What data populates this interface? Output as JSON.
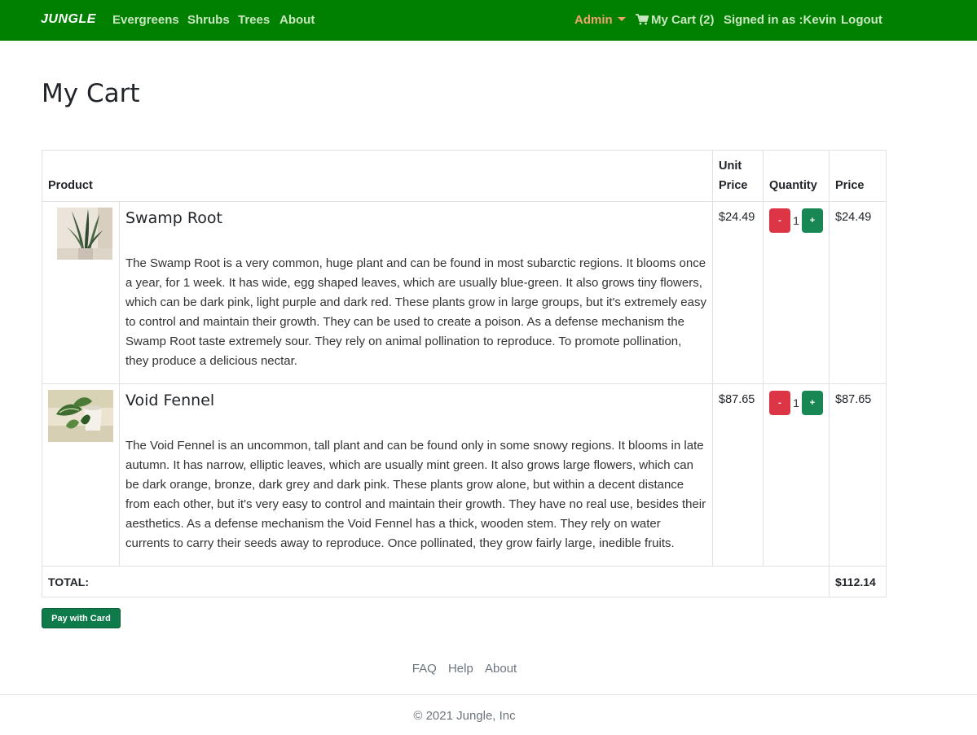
{
  "nav": {
    "brand": "JUNGLE",
    "links": [
      "Evergreens",
      "Shrubs",
      "Trees",
      "About"
    ],
    "admin": "Admin",
    "cart": "My Cart (2)",
    "signed_in": "Signed in as :Kevin",
    "logout": "Logout",
    "bg_color": "#008000"
  },
  "page_title": "My Cart",
  "table": {
    "headers": {
      "product": "Product",
      "unit_price_line1": "Unit",
      "unit_price_line2": "Price",
      "quantity": "Quantity",
      "price": "Price"
    },
    "items": [
      {
        "name": "Swamp Root",
        "description": "The Swamp Root is a very common, huge plant and can be found in most subarctic regions. It blooms once a year, for 1 week. It has wide, egg shaped leaves, which are usually blue-green. It also grows tiny flowers, which can be dark pink, light purple and dark red. These plants grow in large groups, but it's extremely easy to control and maintain their growth. They can be used to create a poison. As a defense mechanism the Swamp Root taste extremely sour. They rely on animal pollination to reproduce. To promote pollination, they produce a delicious nectar.",
        "unit_price": "$24.49",
        "quantity": "1",
        "price": "$24.49",
        "minus": "-",
        "plus": "+"
      },
      {
        "name": "Void Fennel",
        "description": "The Void Fennel is an uncommon, tall plant and can be found only in some snowy regions. It blooms in late autumn. It has narrow, elliptic leaves, which are usually mint green. It also grows large flowers, which can be dark orange, bronze, dark grey and dark pink. These plants grow alone, but within a decent distance from each other, but it's very easy to control and maintain their growth. They have no real use, besides their aesthetics. As a defense mechanism the Void Fennel has a thick, wooden stem. They rely on water currents to carry their seeds away to reproduce. Once pollinated, they grow fairly large, inedible fruits.",
        "unit_price": "$87.65",
        "quantity": "1",
        "price": "$87.65",
        "minus": "-",
        "plus": "+"
      }
    ],
    "total_label": "TOTAL:",
    "total_value": "$112.14"
  },
  "pay_button": "Pay with Card",
  "footer": {
    "links": [
      "FAQ",
      "Help",
      "About"
    ],
    "copyright": "© 2021 Jungle, Inc"
  }
}
